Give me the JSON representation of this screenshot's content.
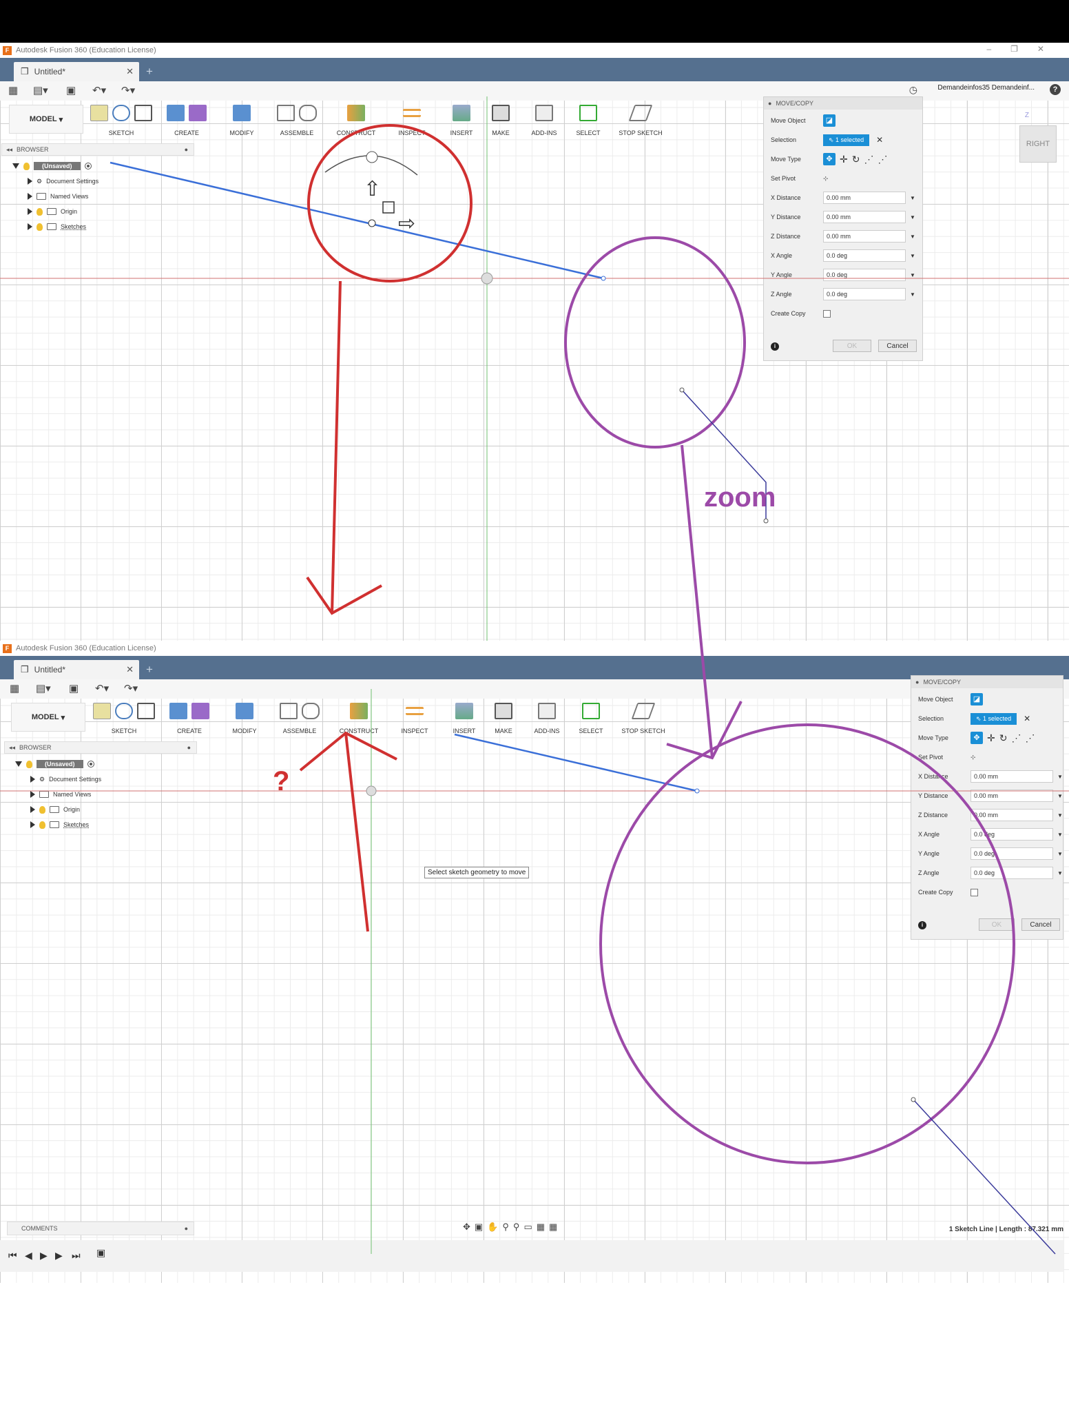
{
  "app_title": "Autodesk Fusion 360 (Education License)",
  "doc_tab": "Untitled*",
  "user": "Demandeinfos35 Demandeinf...",
  "mode": "MODEL",
  "toolbar": [
    "SKETCH",
    "CREATE",
    "MODIFY",
    "ASSEMBLE",
    "CONSTRUCT",
    "INSPECT",
    "INSERT",
    "MAKE",
    "ADD-INS",
    "SELECT",
    "STOP SKETCH"
  ],
  "browser": {
    "title": "BROWSER",
    "root": "(Unsaved)",
    "items": [
      "Document Settings",
      "Named Views",
      "Origin",
      "Sketches"
    ]
  },
  "panel": {
    "title": "MOVE/COPY",
    "move_object": "Move Object",
    "selection_label": "Selection",
    "selection_value": "1 selected",
    "move_type": "Move Type",
    "set_pivot": "Set Pivot",
    "fields": [
      {
        "label": "X Distance",
        "value": "0.00 mm"
      },
      {
        "label": "Y Distance",
        "value": "0.00 mm"
      },
      {
        "label": "Z Distance",
        "value": "0.00 mm"
      },
      {
        "label": "X Angle",
        "value": "0.0 deg"
      },
      {
        "label": "Y Angle",
        "value": "0.0 deg"
      },
      {
        "label": "Z Angle",
        "value": "0.0 deg"
      }
    ],
    "create_copy": "Create Copy",
    "ok": "OK",
    "cancel": "Cancel"
  },
  "viewcube_label": "RIGHT",
  "viewcube_axis": "Z",
  "tooltip": "Select sketch geometry to move",
  "comments": "COMMENTS",
  "status": "1 Sketch Line | Length : 87.321 mm",
  "annotations": {
    "zoom": "zoom",
    "question": "?"
  },
  "colors": {
    "tabbar": "#55708f",
    "accent": "#1a8fd6",
    "red_annotation": "#d03030",
    "purple_annotation": "#9c4aa8",
    "sketch_line": "#3a6fd8"
  }
}
